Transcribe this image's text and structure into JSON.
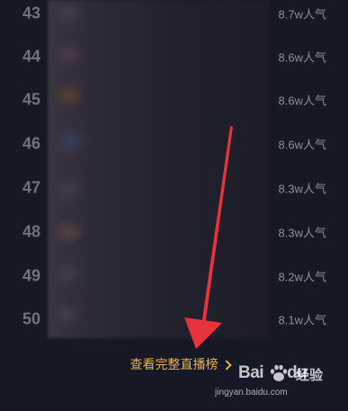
{
  "ranking": {
    "rows": [
      {
        "rank": "43",
        "popularity": "8.7w人气"
      },
      {
        "rank": "44",
        "popularity": "8.6w人气"
      },
      {
        "rank": "45",
        "popularity": "8.6w人气"
      },
      {
        "rank": "46",
        "popularity": "8.6w人气"
      },
      {
        "rank": "47",
        "popularity": "8.3w人气"
      },
      {
        "rank": "48",
        "popularity": "8.3w人气"
      },
      {
        "rank": "49",
        "popularity": "8.2w人气"
      },
      {
        "rank": "50",
        "popularity": "8.1w人气"
      }
    ]
  },
  "footer": {
    "full_board_label": "查看完整直播榜",
    "chevron_icon": "chevron-right-icon"
  },
  "annotation": {
    "arrow_icon": "red-arrow-icon",
    "arrow_color": "#e8333a"
  },
  "watermark": {
    "brand_part1": "Bai",
    "brand_part2": "du",
    "paw_icon": "baidu-paw-icon",
    "product": "经验",
    "url": "jingyan.baidu.com"
  },
  "colors": {
    "background": "#171825",
    "accent": "#e9b53f",
    "rank_number": "#70727d",
    "popularity_text": "#8c8e98"
  }
}
